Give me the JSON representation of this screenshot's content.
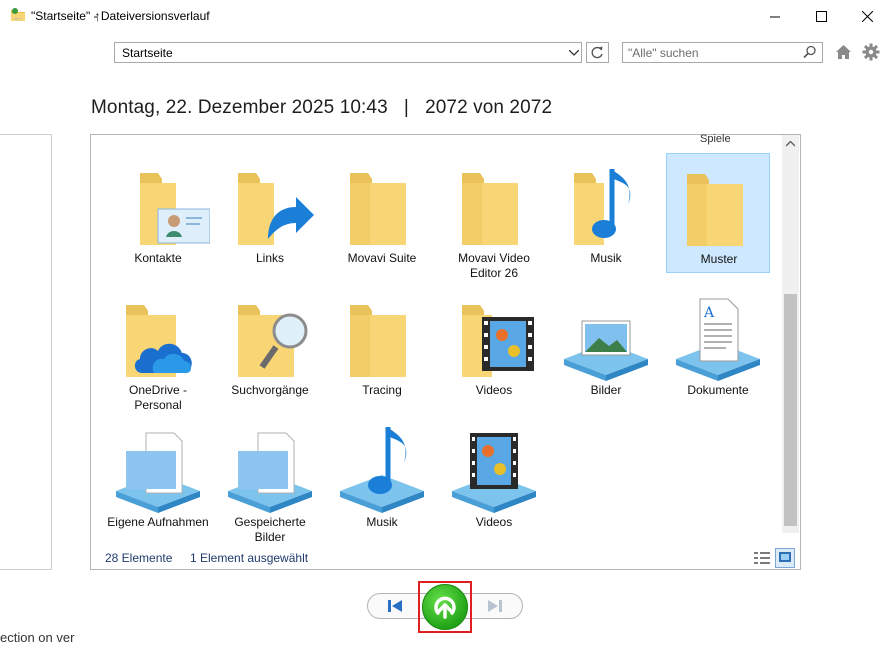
{
  "window": {
    "title": "\"Startseite\" - Dateiversionsverlauf",
    "controls": {
      "minimize": "—",
      "maximize": "☐",
      "close": "✕"
    }
  },
  "nav": {
    "back": "←",
    "forward": "→",
    "recent": "⌄",
    "up": "↑",
    "address": "Startseite",
    "search_placeholder": "\"Alle\" suchen"
  },
  "heading": {
    "date": "Montag, 22. Dezember 2025 10:43",
    "separator": "|",
    "version": "2072 von 2072"
  },
  "clipped_top_label": "Spiele",
  "items": [
    {
      "label": "Kontakte",
      "icon": "contacts-folder-icon",
      "selected": false
    },
    {
      "label": "Links",
      "icon": "links-folder-icon",
      "selected": false
    },
    {
      "label": "Movavi Suite",
      "icon": "folder-icon",
      "selected": false
    },
    {
      "label": "Movavi Video Editor 26",
      "icon": "folder-icon",
      "selected": false
    },
    {
      "label": "Musik",
      "icon": "music-folder-icon",
      "selected": false
    },
    {
      "label": "Muster",
      "icon": "folder-icon",
      "selected": true
    },
    {
      "label": "OneDrive - Personal",
      "icon": "onedrive-folder-icon",
      "selected": false
    },
    {
      "label": "Suchvorgänge",
      "icon": "searches-folder-icon",
      "selected": false
    },
    {
      "label": "Tracing",
      "icon": "folder-icon",
      "selected": false
    },
    {
      "label": "Videos",
      "icon": "videos-folder-icon",
      "selected": false
    },
    {
      "label": "Bilder",
      "icon": "pictures-library-icon",
      "selected": false
    },
    {
      "label": "Dokumente",
      "icon": "documents-library-icon",
      "selected": false
    },
    {
      "label": "Eigene Aufnahmen",
      "icon": "recordings-library-icon",
      "selected": false
    },
    {
      "label": "Gespeicherte Bilder",
      "icon": "saved-pictures-library-icon",
      "selected": false
    },
    {
      "label": "Musik",
      "icon": "music-library-icon",
      "selected": false
    },
    {
      "label": "Videos",
      "icon": "videos-library-icon",
      "selected": false
    }
  ],
  "status": {
    "count": "28 Elemente",
    "selected": "1 Element ausgewählt"
  },
  "playback": {
    "previous": "previous-version",
    "restore": "restore",
    "next": "next-version"
  },
  "bottom_clipped_text": "ection on ver",
  "colors": {
    "accent": "#0078d7",
    "selection_bg": "#cde8ff",
    "restore_green": "#2bb51f",
    "highlight_red": "#e02020",
    "folder_yellow": "#f8d676"
  }
}
